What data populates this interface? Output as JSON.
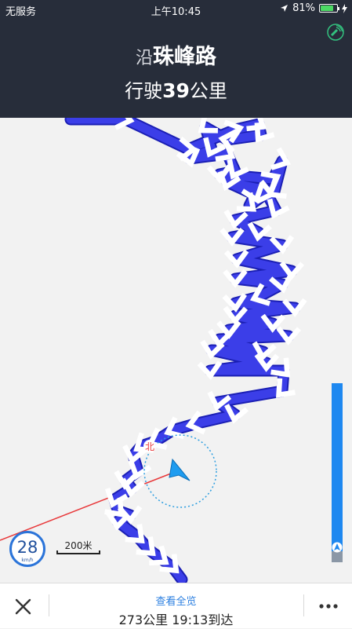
{
  "status_bar": {
    "carrier": "无服务",
    "time": "上午10:45",
    "battery": "81%",
    "battery_level": 0.81
  },
  "nav": {
    "road_prefix": "沿",
    "road_name": "珠峰路",
    "distance_prefix": "行驶",
    "distance_value": "39",
    "distance_unit": "公里"
  },
  "map": {
    "north_label": "北",
    "speed": "28",
    "speed_unit": "km/h",
    "scale_label": "200米",
    "route_progress": 0.94,
    "colors": {
      "route": "#3b3ee8",
      "route_edge": "#1b1fb4",
      "car": "#1e9cf0",
      "heading_line": "#e8393b"
    }
  },
  "bottom": {
    "overview_label": "查看全览",
    "eta": "273公里 19:13到达"
  }
}
